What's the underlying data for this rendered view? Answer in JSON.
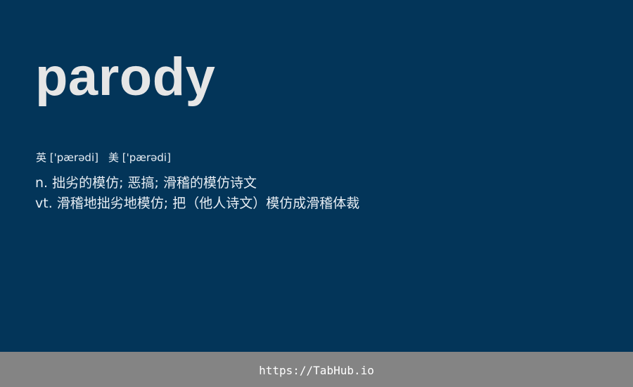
{
  "entry": {
    "word": "parody",
    "phonetics": {
      "uk_label": "英",
      "uk_ipa": "['pærədi]",
      "us_label": "美",
      "us_ipa": "['pærədi]"
    },
    "definitions": [
      "n. 拙劣的模仿; 恶搞; 滑稽的模仿诗文",
      "vt. 滑稽地拙劣地模仿; 把（他人诗文）模仿成滑稽体裁"
    ]
  },
  "footer": {
    "link_text": "https://TabHub.io"
  },
  "colors": {
    "background": "#033559",
    "word": "#e6e6e6",
    "text": "#e8eef4",
    "footer_bg": "#848484",
    "footer_text": "#ffffff"
  }
}
